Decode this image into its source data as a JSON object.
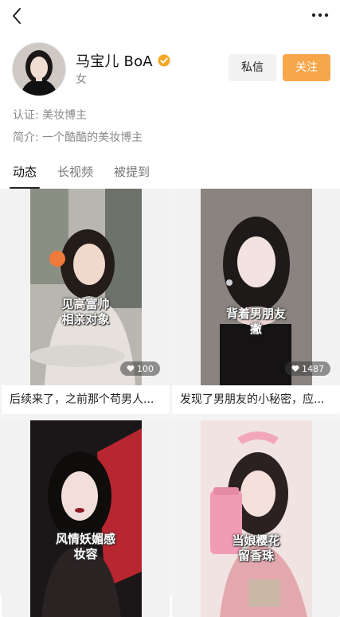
{
  "profile": {
    "name": "马宝儿 BoA",
    "gender": "女",
    "verify_label": "认证:",
    "verify_value": "美妆博主",
    "bio_label": "简介:",
    "bio_value": "一个酷酷的美妆博主",
    "dm_button": "私信",
    "follow_button": "关注"
  },
  "tabs": [
    {
      "label": "动态",
      "active": true
    },
    {
      "label": "长视频",
      "active": false
    },
    {
      "label": "被提到",
      "active": false
    }
  ],
  "posts": [
    {
      "overlay": [
        "见高富帅",
        "相亲对象"
      ],
      "likes": "100",
      "caption": "后续来了，之前那个苟男人..."
    },
    {
      "overlay": [
        "背着男朋友",
        "撇"
      ],
      "likes": "1487",
      "caption": "发现了男朋友的小秘密，应..."
    },
    {
      "overlay": [
        "风情妖媚感",
        "妆容"
      ],
      "likes": "",
      "caption": ""
    },
    {
      "overlay": [
        "当娘樱花",
        "留香珠"
      ],
      "likes": "",
      "caption": ""
    }
  ],
  "colors": {
    "accent": "#f7a64a",
    "verified": "#f5a623"
  }
}
